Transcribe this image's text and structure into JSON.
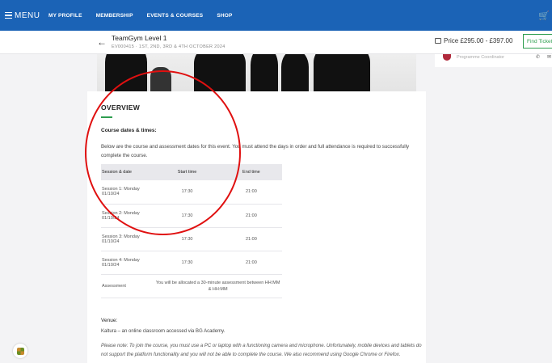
{
  "nav": {
    "menu_label": "MENU",
    "items": [
      "MY PROFILE",
      "MEMBERSHIP",
      "EVENTS & COURSES",
      "SHOP"
    ],
    "cart_icon": "cart-icon"
  },
  "event": {
    "title": "TeamGym Level 1",
    "subtitle": "EV000415 · 1ST, 2ND, 3RD & 4TH OCTOBER 2024",
    "price": "Price £295.00 - £397.00",
    "find_tickets": "Find Tickets"
  },
  "coordinator": {
    "role": "Programme Coordinator"
  },
  "overview": {
    "heading": "OVERVIEW",
    "subheading": "Course dates & times:",
    "intro": "Below are the course and assessment dates for this event. You must attend the days in order and full attendance is required to successfully complete the course.",
    "table": {
      "headers": [
        "Session & date",
        "Start time",
        "End time"
      ],
      "rows": [
        [
          "Session 1: Monday 01/10/24",
          "17:30",
          "21:00"
        ],
        [
          "Session 2: Monday 01/10/24",
          "17:30",
          "21:00"
        ],
        [
          "Session 3: Monday 01/10/24",
          "17:30",
          "21:00"
        ],
        [
          "Session 4: Monday 01/10/24",
          "17:30",
          "21:00"
        ]
      ],
      "assessment_label": "Assessment",
      "assessment_note": "You will be allocated a 30-minute assessment between HH:MM & HH:MM"
    },
    "venue_label": "Venue:",
    "venue_text": "Kaltura – an online classroom accessed via BG Academy.",
    "note": "Please note: To join the course, you must use a PC or laptop with a functioning camera and microphone. Unfortunately, mobile devices and tablets do not support the platform functionality and you will not be able to complete the course. We also recommend using Google Chrome or Firefox."
  },
  "colors": {
    "nav_bg": "#1b63b6",
    "accent_green": "#2e9e4f",
    "annotation_red": "#e01010"
  }
}
